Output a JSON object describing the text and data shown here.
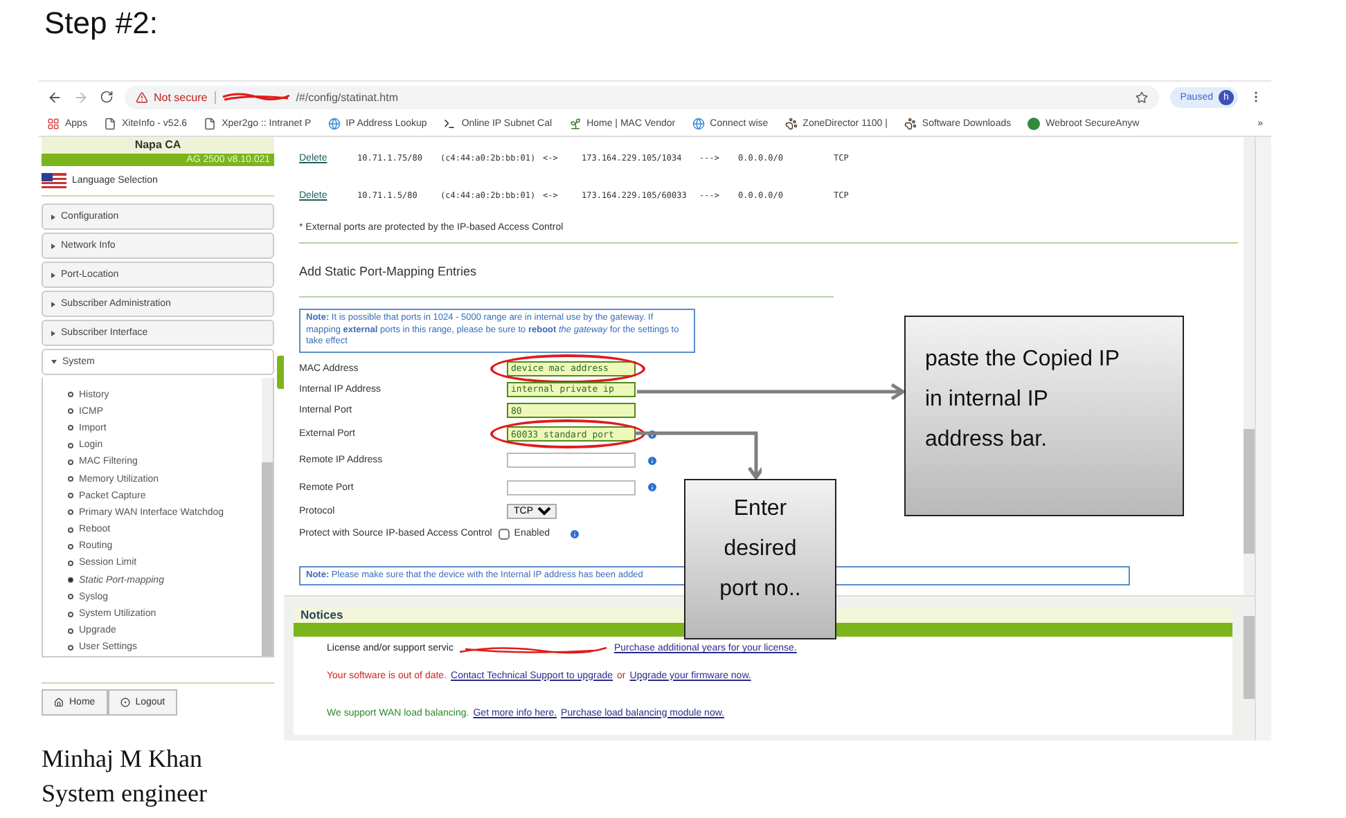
{
  "heading": "Step #2:",
  "browser": {
    "security": "Not secure",
    "url": "/#/config/statinat.htm",
    "url_redacted": true,
    "profile_button": "Paused",
    "profile_initial": "h",
    "overflow": "»",
    "bookmarks": [
      {
        "label": "Apps",
        "kind": "apps"
      },
      {
        "label": "XiteInfo - v52.6",
        "kind": "page"
      },
      {
        "label": "Xper2go :: Intranet P",
        "kind": "page"
      },
      {
        "label": "IP Address Lookup",
        "kind": "globe"
      },
      {
        "label": "Online IP Subnet Cal",
        "kind": "terminal"
      },
      {
        "label": "Home | MAC Vendor",
        "kind": "plant"
      },
      {
        "label": "Connect wise",
        "kind": "globe"
      },
      {
        "label": "ZoneDirector 1100 |",
        "kind": "paw"
      },
      {
        "label": "Software Downloads",
        "kind": "paw"
      },
      {
        "label": "Webroot SecureAnyw",
        "kind": "circle"
      }
    ]
  },
  "sidebar": {
    "site": "Napa CA",
    "version": "AG 2500 v8.10.021",
    "language": "Language Selection",
    "sections": [
      {
        "label": "Configuration",
        "expanded": false
      },
      {
        "label": "Network Info",
        "expanded": false
      },
      {
        "label": "Port-Location",
        "expanded": false
      },
      {
        "label": "Subscriber Administration",
        "expanded": false
      },
      {
        "label": "Subscriber Interface",
        "expanded": false
      },
      {
        "label": "System",
        "expanded": true
      }
    ],
    "items": [
      {
        "label": "History",
        "selected": false
      },
      {
        "label": "ICMP",
        "selected": false
      },
      {
        "label": "Import",
        "selected": false
      },
      {
        "label": "Login",
        "selected": false
      },
      {
        "label": "MAC Filtering",
        "selected": false
      },
      {
        "label": "Memory Utilization",
        "selected": false
      },
      {
        "label": "Packet Capture",
        "selected": false
      },
      {
        "label": "Primary WAN Interface Watchdog",
        "selected": false
      },
      {
        "label": "Reboot",
        "selected": false
      },
      {
        "label": "Routing",
        "selected": false
      },
      {
        "label": "Session Limit",
        "selected": false
      },
      {
        "label": "Static Port-mapping",
        "selected": true
      },
      {
        "label": "Syslog",
        "selected": false
      },
      {
        "label": "System Utilization",
        "selected": false
      },
      {
        "label": "Upgrade",
        "selected": false
      },
      {
        "label": "User Settings",
        "selected": false
      }
    ],
    "buttons": [
      {
        "label": "Home",
        "kind": "home"
      },
      {
        "label": "Logout",
        "kind": "logout"
      }
    ]
  },
  "mappings": [
    {
      "action": "Delete",
      "internal": "10.71.1.75/80",
      "mac": "(c4:44:a0:2b:bb:01)",
      "link": "<->",
      "external": "173.164.229.105/1034",
      "arrow": "--->",
      "remote": "0.0.0.0/0",
      "protocol": "TCP"
    },
    {
      "action": "Delete",
      "internal": "10.71.1.5/80",
      "mac": "(c4:44:a0:2b:bb:01)",
      "link": "<->",
      "external": "173.164.229.105/60033",
      "arrow": "--->",
      "remote": "0.0.0.0/0",
      "protocol": "TCP"
    }
  ],
  "footnote": "* External ports are protected by the IP-based Access Control",
  "form": {
    "title": "Add Static Port-Mapping Entries",
    "note": "**Note:** It is possible that ports in 1024 - 5000 range are in internal use by the gateway. If mapping **external** ports in this range, please be sure to **reboot** *the gateway* for the settings to take effect",
    "fields": [
      {
        "label": "MAC Address",
        "kind": "text",
        "value": "device mac address",
        "highlighted": true,
        "circled": true,
        "info": false
      },
      {
        "label": "Internal IP Address",
        "kind": "text",
        "value": "internal private ip",
        "highlighted": true,
        "circled": false,
        "info": false
      },
      {
        "label": "Internal Port",
        "kind": "text",
        "value": "80",
        "highlighted": true,
        "circled": false,
        "info": false
      },
      {
        "label": "External Port",
        "kind": "text",
        "value": "60033 standard port",
        "highlighted": true,
        "circled": true,
        "info": true
      },
      {
        "label": "Remote IP Address",
        "kind": "text",
        "highlighted": false,
        "circled": false,
        "info": true
      },
      {
        "label": "Remote Port",
        "kind": "text",
        "highlighted": false,
        "circled": false,
        "info": true
      },
      {
        "label": "Protocol",
        "kind": "select",
        "value": "TCP"
      },
      {
        "label": "Protect with Source IP-based Access Control",
        "kind": "checkbox",
        "value": "Enabled",
        "checked": false,
        "info": true
      }
    ],
    "note2": "**Note:** Please make sure that the device with the Internal IP address has been added"
  },
  "notices": {
    "title": "Notices",
    "lines": [
      {
        "color": "#222222",
        "parts": [
          {
            "kind": "plain",
            "text": "License and/or support servic"
          },
          {
            "kind": "redaction"
          },
          {
            "kind": "link",
            "text": "Purchase additional years for your license."
          }
        ]
      },
      {
        "color": "#d21f1f",
        "parts": [
          {
            "kind": "plain",
            "text": "Your software is out of date."
          },
          {
            "kind": "link",
            "text": "Contact Technical Support to upgrade"
          },
          {
            "kind": "plain",
            "text": "or"
          },
          {
            "kind": "link",
            "text": "Upgrade your firmware now."
          }
        ]
      },
      {
        "color": "#2b8a2b",
        "parts": [
          {
            "kind": "plain",
            "text": "We support WAN load balancing."
          },
          {
            "kind": "link",
            "text": "Get more info here."
          },
          {
            "kind": "link",
            "text": "Purchase  load balancing module now."
          }
        ]
      }
    ]
  },
  "callouts": [
    {
      "text": "paste the Copied IP in internal IP address bar.",
      "kind": "wide"
    },
    {
      "text": "Enter desired port no..",
      "kind": "narrow"
    }
  ],
  "author": [
    "Minhaj M Khan",
    "System engineer"
  ]
}
